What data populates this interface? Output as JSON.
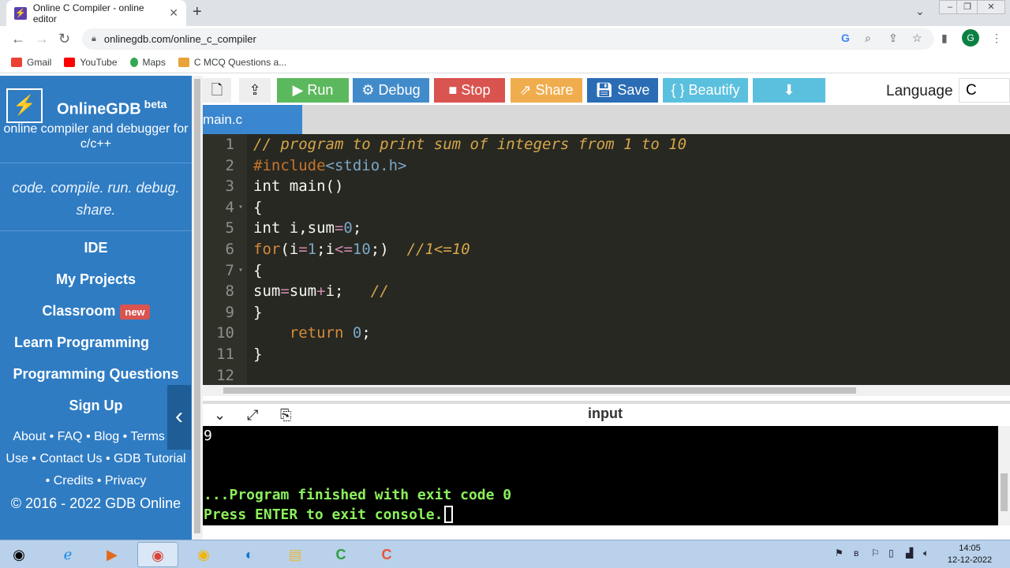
{
  "browser": {
    "tab_title": "Online C Compiler - online editor",
    "tab_close": "✕",
    "new_tab": "+",
    "url": "onlinegdb.com/online_c_compiler",
    "profile_initial": "G",
    "bookmarks": [
      {
        "label": "Gmail",
        "color": "#ea4335"
      },
      {
        "label": "YouTube",
        "color": "#ff0000"
      },
      {
        "label": "Maps",
        "color": "#34a853"
      },
      {
        "label": "C MCQ Questions a...",
        "color": "#e8a33a"
      }
    ]
  },
  "sidebar": {
    "brand_name": "OnlineGDB",
    "brand_sup": "beta",
    "tagline": "online compiler and debugger for c/c++",
    "motto": "code. compile. run. debug. share.",
    "menu": {
      "ide": "IDE",
      "projects": "My Projects",
      "classroom": "Classroom",
      "classroom_badge": "new",
      "learn": "Learn Programming",
      "questions": "Programming Questions",
      "signup": "Sign Up"
    },
    "links": "About • FAQ • Blog • Terms of Use • Contact Us • GDB Tutorial • Credits • Privacy",
    "copyright": "© 2016 - 2022 GDB Online"
  },
  "toolbar": {
    "run": "Run",
    "debug": "Debug",
    "stop": "Stop",
    "share": "Share",
    "save": "Save",
    "beautify": "{ } Beautify",
    "language_label": "Language",
    "language_value": "C"
  },
  "file_tab": "main.c",
  "editor": {
    "line_numbers": [
      "1",
      "2",
      "3",
      "4",
      "5",
      "6",
      "7",
      "8",
      "9",
      "10",
      "11",
      "12"
    ]
  },
  "console": {
    "title": "input",
    "output": "9",
    "finished": "...Program finished with exit code 0",
    "press": "Press ENTER to exit console."
  },
  "taskbar": {
    "time": "14:05",
    "date": "12-12-2022"
  },
  "colors": {
    "run": "#5cb85c",
    "debug": "#428bca",
    "stop": "#d9534f",
    "share": "#f0ad4e",
    "save": "#2a6db5",
    "beautify": "#5bc0de",
    "download": "#5bc0de",
    "sidebar": "#2f7cc3"
  }
}
